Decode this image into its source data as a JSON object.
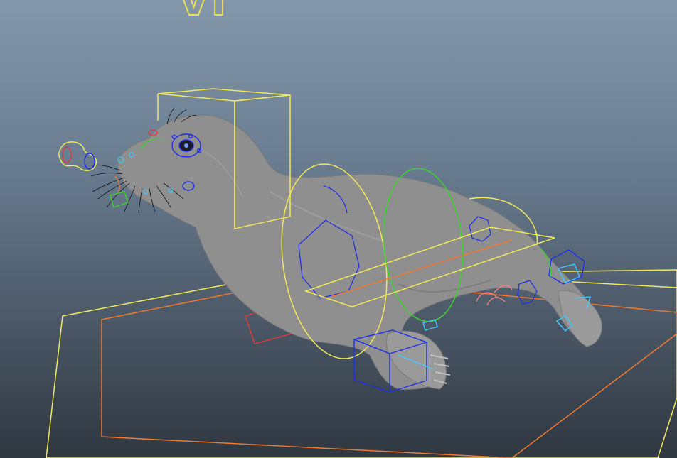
{
  "viewport": {
    "hud_label": "VI",
    "background_top": "#8497ab",
    "background_bottom": "#2f3740"
  },
  "colors": {
    "ctrl_yellow": "#f0e85a",
    "ctrl_orange": "#f07830",
    "ctrl_green": "#3ed22e",
    "ctrl_blue": "#2030e8",
    "ctrl_cyan": "#40c8ff",
    "ctrl_red": "#e03a3a",
    "ctrl_pink": "#ff8080",
    "mesh_gray": "#8f8f8f",
    "whisker_black": "#111111"
  },
  "scene": {
    "model": "seal-mesh",
    "icons": [
      "ground-plane-control",
      "head-control-box",
      "body-ring-control",
      "spine-ring-control",
      "flipper-control",
      "tail-control",
      "eye-control",
      "jaw-control"
    ]
  }
}
